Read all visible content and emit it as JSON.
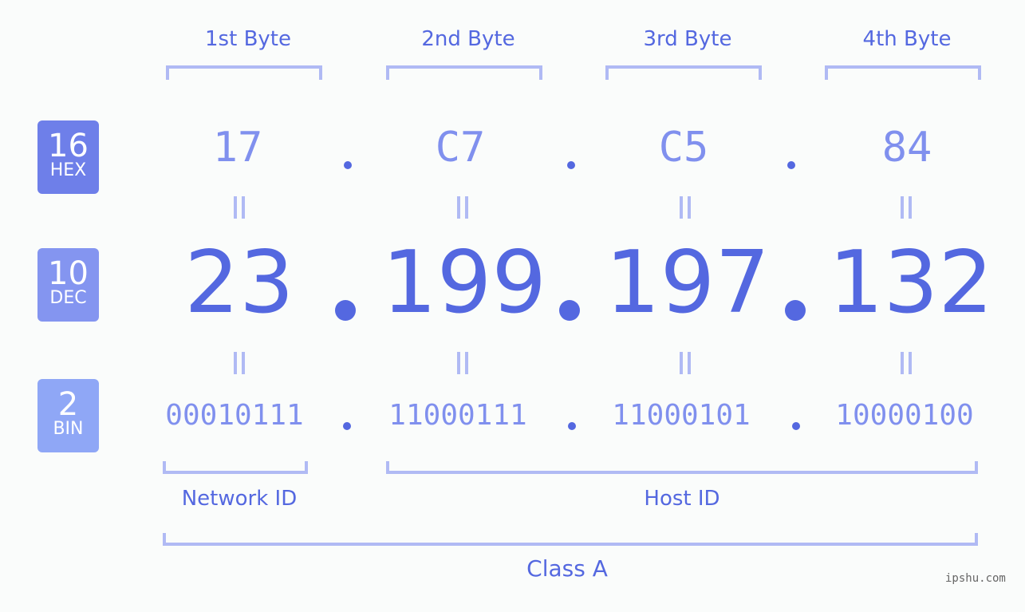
{
  "headers": [
    "1st Byte",
    "2nd Byte",
    "3rd Byte",
    "4th Byte"
  ],
  "badges": {
    "hex": {
      "num": "16",
      "label": "HEX",
      "color": "#6e7fe9"
    },
    "dec": {
      "num": "10",
      "label": "DEC",
      "color": "#8495f0"
    },
    "bin": {
      "num": "2",
      "label": "BIN",
      "color": "#8fa7f6"
    }
  },
  "hex": [
    "17",
    "C7",
    "C5",
    "84"
  ],
  "dec": [
    "23",
    "199",
    "197",
    "132"
  ],
  "bin": [
    "00010111",
    "11000111",
    "11000101",
    "10000100"
  ],
  "equals": "=",
  "labels": {
    "network": "Network ID",
    "host": "Host ID",
    "class": "Class A"
  },
  "watermark": "ipshu.com"
}
